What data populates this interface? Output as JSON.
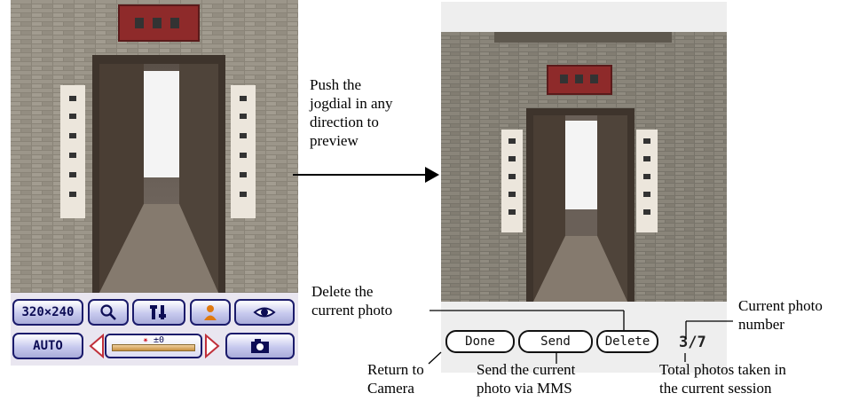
{
  "left_screen": {
    "buttons": {
      "resolution": "320×240",
      "zoom_icon": "magnifier-icon",
      "settings_icon": "tools-icon",
      "person_icon": "person-icon",
      "eye_icon": "eye-icon",
      "auto": "AUTO",
      "camera_icon": "camera-icon"
    },
    "exposure_label": "±0"
  },
  "right_screen": {
    "buttons": {
      "done": "Done",
      "send": "Send",
      "delete": "Delete"
    },
    "counter": "3/7"
  },
  "annotations": {
    "preview_instruction": [
      "Push the",
      "jogdial in any",
      "direction to",
      "preview"
    ],
    "delete_note": [
      "Delete the",
      "current photo"
    ],
    "current_photo_number": [
      "Current photo",
      "number"
    ],
    "return_to_camera": [
      "Return to",
      "Camera"
    ],
    "send_note": [
      "Send the current",
      "photo via MMS"
    ],
    "total_photos": [
      "Total photos taken in",
      "the current session"
    ]
  },
  "colors": {
    "button_border": "#1b1b6b",
    "brick": "#8a8478",
    "door_wood": "#4a3e34",
    "sign_red": "#8e2a2a"
  }
}
